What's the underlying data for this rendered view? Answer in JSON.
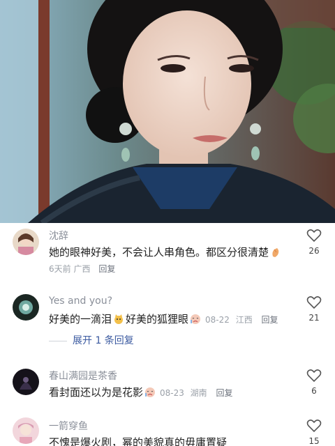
{
  "comments": [
    {
      "username": "沈辞",
      "text": "她的眼神好美，不会让人串角色。都区分很清楚",
      "emoji_after": "clapping-hands-emoji",
      "time": "6天前",
      "location": "广西",
      "reply_label": "回复",
      "likes": "26"
    },
    {
      "username": "Yes and you?",
      "text_part1": "好美的一滴泪",
      "emoji_mid": "cat-emoji",
      "text_part2": "好美的狐狸眼",
      "emoji_after": "crying-face-emoji",
      "date": "08-22",
      "location": "江西",
      "reply_label": "回复",
      "likes": "21",
      "expand_label": "展开 1 条回复"
    },
    {
      "username": "春山满园是茶香",
      "text": "看封面还以为是花影",
      "emoji_after": "crying-face-emoji",
      "date": "08-23",
      "location": "湖南",
      "reply_label": "回复",
      "likes": "6"
    },
    {
      "username": "一箭穿鱼",
      "text": "不愧是爆火剧，幂的美貌真的毋庸置疑",
      "likes": "15"
    }
  ],
  "colors": {
    "username": "#8a8f99",
    "text": "#1f1f1f",
    "meta": "#9aa0a8",
    "expand": "#3b5aa0"
  }
}
